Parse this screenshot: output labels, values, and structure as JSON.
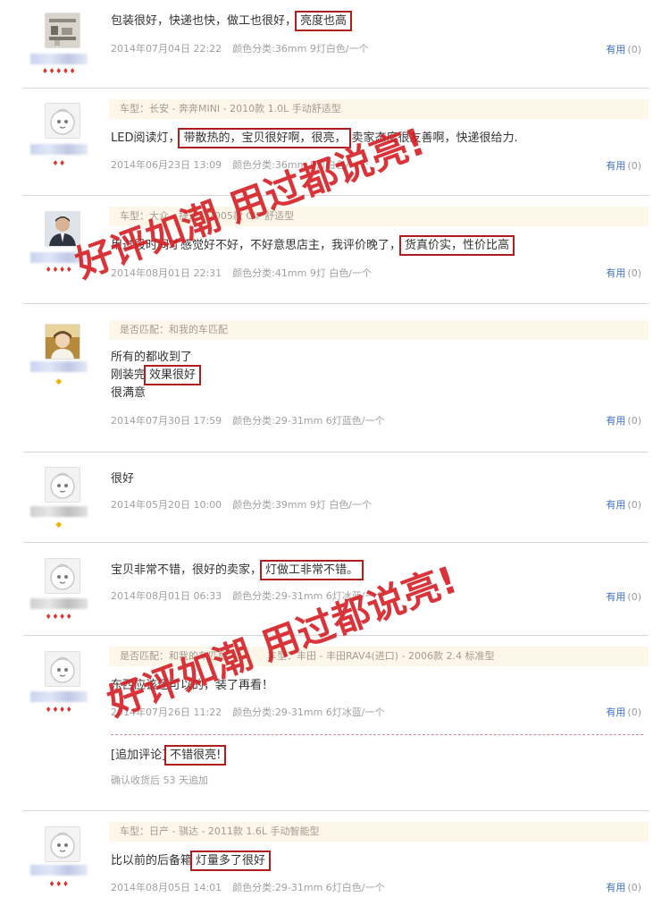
{
  "reviews": [
    {
      "avatar": "photo-shelf",
      "rank": "♦♦♦♦♦",
      "content": [
        "包装很好，快递也快，做工也很好，",
        "亮度也高"
      ],
      "date": "2014年07月04日 22:22",
      "sku": "颜色分类:36mm 9灯白色/一个",
      "helpful_label": "有用",
      "helpful_count": "(0)"
    },
    {
      "avatar": "default",
      "rank": "♦♦",
      "meta": "车型：长安 - 奔奔MINI - 2010款 1.0L 手动舒适型",
      "content": [
        "LED阅读灯，",
        "带散热的，宝贝很好啊，很亮，",
        "卖家态度很友善啊，快递很给力."
      ],
      "date": "2014年06月23日 13:09",
      "sku": "颜色分类:36mm 9灯白色/一个",
      "helpful_label": "有用",
      "helpful_count": "(0)"
    },
    {
      "avatar": "photo-man",
      "rank": "♦♦♦♦",
      "meta": "车型：大众 - 捷达 - 2005款 CIF 舒适型",
      "content": [
        "用过段时间才感觉好不好，不好意思店主，我评价晚了，",
        "货真价实，性价比高"
      ],
      "date": "2014年08月01日 22:31",
      "sku": "颜色分类:41mm 9灯 白色/一个",
      "helpful_label": "有用",
      "helpful_count": "(0)"
    },
    {
      "avatar": "photo-boy",
      "rank": "◆",
      "meta": "是否匹配：和我的车匹配",
      "content_lines": [
        "所有的都收到了",
        "刚装完",
        "效果很好",
        "很满意"
      ],
      "date": "2014年07月30日 17:59",
      "sku": "颜色分类:29-31mm 6灯蓝色/一个",
      "helpful_label": "有用",
      "helpful_count": "(0)"
    },
    {
      "avatar": "default",
      "rank": "◆",
      "content": [
        "很好"
      ],
      "date": "2014年05月20日 10:00",
      "sku": "颜色分类:39mm 9灯 白色/一个",
      "helpful_label": "有用",
      "helpful_count": "(0)"
    },
    {
      "avatar": "default",
      "rank": "♦♦♦♦",
      "content": [
        "宝贝非常不错，很好的卖家，",
        "灯做工非常不错。"
      ],
      "date": "2014年08月01日 06:33",
      "sku": "颜色分类:29-31mm 6灯冰蓝/一个",
      "helpful_label": "有用",
      "helpful_count": "(0)"
    },
    {
      "avatar": "default",
      "rank": "♦♦♦♦",
      "meta": "是否匹配：和我的车匹配",
      "meta2": "车型：丰田 - 丰田RAV4(进口) - 2006款 2.4 标准型",
      "content": [
        "东西应该还可以的，装了再看！"
      ],
      "date": "2014年07月26日 11:22",
      "sku": "颜色分类:29-31mm 6灯冰蓝/一个",
      "helpful_label": "有用",
      "helpful_count": "(0)",
      "append": [
        "[追加评论]",
        "不错很亮!"
      ],
      "append_note": "确认收货后 53 天追加"
    },
    {
      "avatar": "default",
      "rank": "♦♦♦",
      "meta": "车型：日产 - 骐达 - 2011款 1.6L 手动智能型",
      "content": [
        "比以前的后备箱",
        "灯量多了很好"
      ],
      "date": "2014年08月05日 14:01",
      "sku": "颜色分类:29-31mm 6灯白色/一个",
      "helpful_label": "有用",
      "helpful_count": "(0)"
    }
  ],
  "watermarks": [
    "好评如潮 用过都说亮!",
    "好评如潮 用过都说亮!"
  ],
  "colors": {
    "accent": "#b11c1c",
    "link": "#3d6fc5",
    "meta_bg": "#fdf7ea"
  }
}
